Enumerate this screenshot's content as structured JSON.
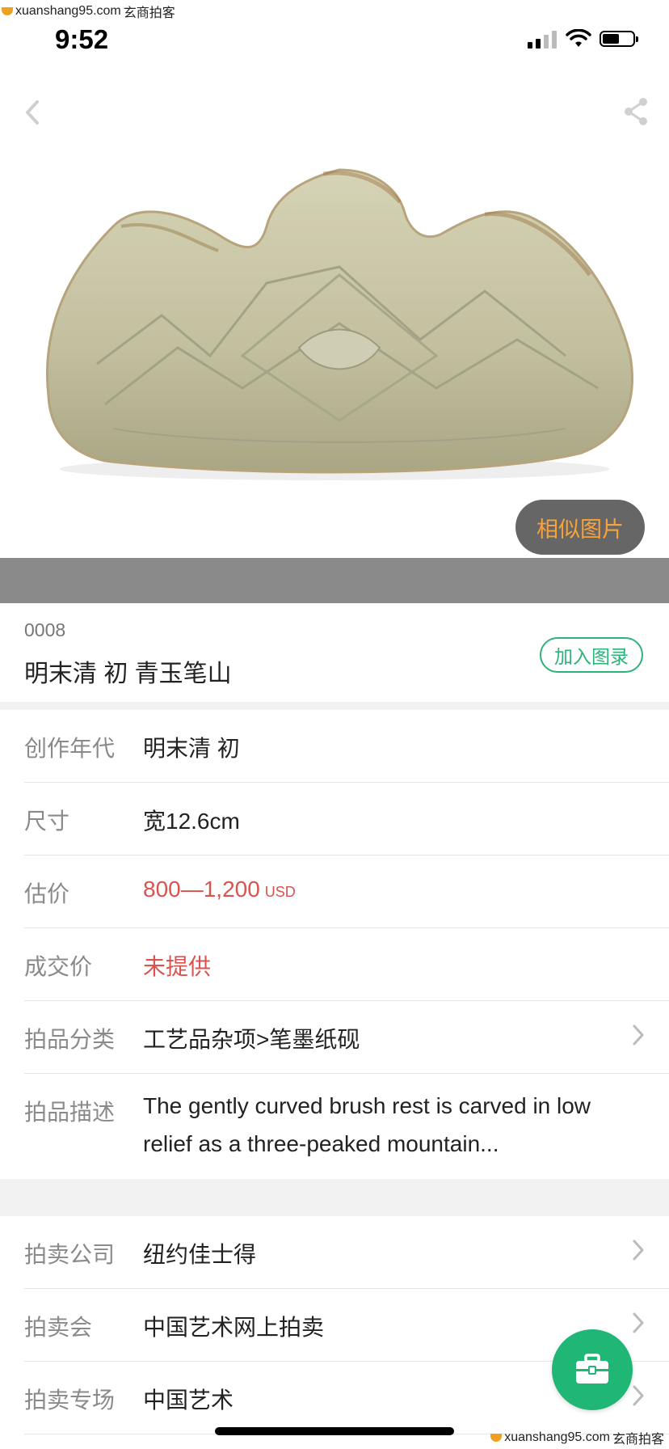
{
  "watermark": {
    "text": "xuanshang95.com",
    "brand": "玄商拍客"
  },
  "status_bar": {
    "time": "9:52"
  },
  "hero": {
    "similar_button": "相似图片"
  },
  "lot": {
    "number": "0008",
    "title": "明末清 初 青玉笔山",
    "add_catalog": "加入图录"
  },
  "details": {
    "era": {
      "label": "创作年代",
      "value": "明末清 初"
    },
    "size": {
      "label": "尺寸",
      "value": "宽12.6cm"
    },
    "estimate": {
      "label": "估价",
      "value": "800—1,200",
      "currency": "USD"
    },
    "sold_price": {
      "label": "成交价",
      "value": "未提供"
    },
    "category": {
      "label": "拍品分类",
      "value": "工艺品杂项>笔墨纸砚"
    },
    "description": {
      "label": "拍品描述",
      "value": "The gently curved brush rest is carved in low relief as a three-peaked mountain..."
    }
  },
  "auction": {
    "company": {
      "label": "拍卖公司",
      "value": "纽约佳士得"
    },
    "sale": {
      "label": "拍卖会",
      "value": "中国艺术网上拍卖"
    },
    "session": {
      "label": "拍卖专场",
      "value": "中国艺术"
    }
  },
  "colors": {
    "accent_green": "#2db37a",
    "price_red": "#d9534f",
    "similar_orange": "#f7a23a"
  }
}
